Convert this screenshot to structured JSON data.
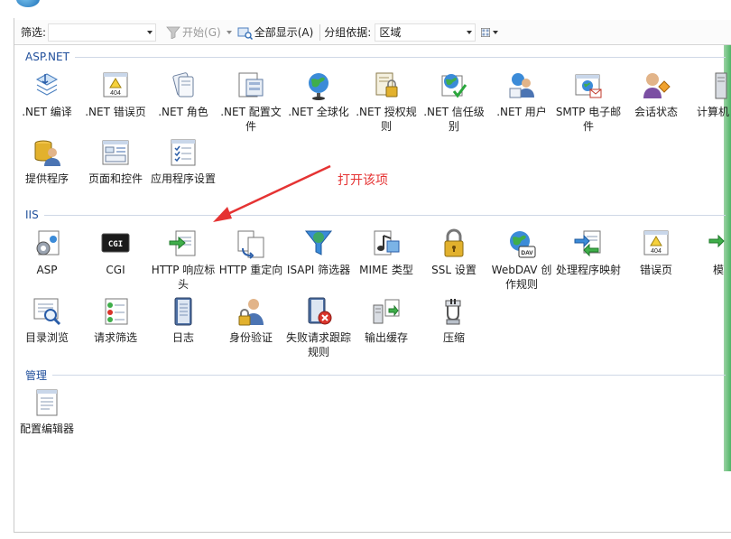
{
  "window": {
    "title": "…"
  },
  "toolbar": {
    "filter_label": "筛选:",
    "filter_value": "",
    "start_label": "开始(G)",
    "show_all_label": "全部显示(A)",
    "group_by_label": "分组依据:",
    "group_by_value": "区域"
  },
  "sections": [
    {
      "title": "ASP.NET",
      "items": [
        {
          "label": ".NET 编译",
          "icon": "net-compile-icon"
        },
        {
          "label": ".NET 错误页",
          "icon": "net-error-page-icon"
        },
        {
          "label": ".NET 角色",
          "icon": "net-roles-icon"
        },
        {
          "label": ".NET 配置文件",
          "icon": "net-profile-icon"
        },
        {
          "label": ".NET 全球化",
          "icon": "net-globalization-icon"
        },
        {
          "label": ".NET 授权规则",
          "icon": "net-authorization-icon"
        },
        {
          "label": ".NET 信任级别",
          "icon": "net-trust-level-icon"
        },
        {
          "label": ".NET 用户",
          "icon": "net-users-icon"
        },
        {
          "label": "SMTP 电子邮件",
          "icon": "smtp-email-icon"
        },
        {
          "label": "会话状态",
          "icon": "session-state-icon"
        },
        {
          "label": "计算机",
          "icon": "machine-key-icon"
        },
        {
          "label": "提供程序",
          "icon": "providers-icon"
        },
        {
          "label": "页面和控件",
          "icon": "pages-controls-icon"
        },
        {
          "label": "应用程序设置",
          "icon": "app-settings-icon"
        }
      ]
    },
    {
      "title": "IIS",
      "items": [
        {
          "label": "ASP",
          "icon": "asp-icon"
        },
        {
          "label": "CGI",
          "icon": "cgi-icon"
        },
        {
          "label": "HTTP 响应标头",
          "icon": "http-response-headers-icon"
        },
        {
          "label": "HTTP 重定向",
          "icon": "http-redirect-icon"
        },
        {
          "label": "ISAPI 筛选器",
          "icon": "isapi-filters-icon"
        },
        {
          "label": "MIME 类型",
          "icon": "mime-types-icon"
        },
        {
          "label": "SSL 设置",
          "icon": "ssl-settings-icon"
        },
        {
          "label": "WebDAV 创作规则",
          "icon": "webdav-icon"
        },
        {
          "label": "处理程序映射",
          "icon": "handler-mappings-icon"
        },
        {
          "label": "错误页",
          "icon": "error-pages-icon"
        },
        {
          "label": "模",
          "icon": "modules-icon"
        },
        {
          "label": "目录浏览",
          "icon": "directory-browsing-icon"
        },
        {
          "label": "请求筛选",
          "icon": "request-filtering-icon"
        },
        {
          "label": "日志",
          "icon": "logging-icon"
        },
        {
          "label": "身份验证",
          "icon": "authentication-icon"
        },
        {
          "label": "失败请求跟踪规则",
          "icon": "failed-request-tracing-icon"
        },
        {
          "label": "输出缓存",
          "icon": "output-caching-icon"
        },
        {
          "label": "压缩",
          "icon": "compression-icon"
        }
      ]
    },
    {
      "title": "管理",
      "items": [
        {
          "label": "配置编辑器",
          "icon": "configuration-editor-icon"
        }
      ]
    }
  ],
  "annotation": {
    "text": "打开该项",
    "color": "#e53333"
  }
}
